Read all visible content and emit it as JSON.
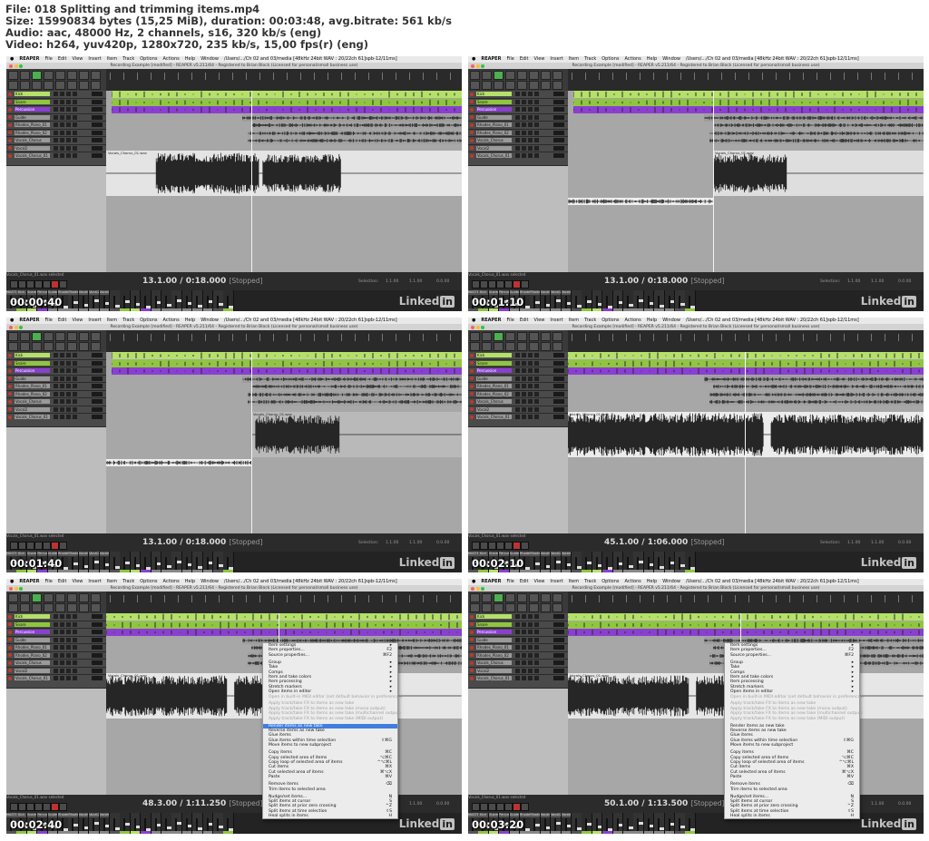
{
  "header": {
    "lines": [
      "File: 018 Splitting and trimming items.mp4",
      "Size: 15990834 bytes (15,25 MiB), duration: 00:03:48, avg.bitrate: 561 kb/s",
      "Audio: aac, 48000 Hz, 2 channels, s16, 320 kb/s (eng)",
      "Video: h264, yuv420p, 1280x720, 235 kb/s, 15,00 fps(r) (eng)"
    ]
  },
  "app": {
    "menu": [
      "REAPER",
      "File",
      "Edit",
      "View",
      "Insert",
      "Item",
      "Track",
      "Options",
      "Actions",
      "Help",
      "Window"
    ],
    "menu_path": "/Users/.../Ch 02 and 03/media [48kHz 24bit WAV : 20/22ch 61]spb-12/11ms]",
    "window_title": "Recording Example [modified] - REAPER v5.211/64 - Registered to Brian Block (Licensed for personal/small business use)",
    "tracks": [
      "Kick",
      "Snare",
      "Percussion",
      "Guide",
      "Rhodes_Piano_01",
      "Rhodes_Piano_02",
      "Vocals_Chorus",
      "Vocal2",
      "Vocals_Chorus_01"
    ],
    "item_label": "Vocals_Chorus_01.wav",
    "transport_label": "Vocals_Chorus_01.wav selected",
    "selection_label": "Selection:",
    "selection_start": "1.1.00",
    "selection_end": "1.1.00",
    "selection_len": "0.0.00",
    "mixer_labels": [
      "MASTER",
      "Kick",
      "Snare",
      "Percussion",
      "Guide",
      "Rhodes_Pi_01",
      "Rhodes_Pi_02",
      "Vocals_Ch",
      "Vocal2",
      "Vocals_Ch_01"
    ],
    "stopped": "[Stopped]",
    "linkedin_text": "Linked",
    "linkedin_in": "in"
  },
  "frames": [
    {
      "timestamp": "00:00:40",
      "position": "13.1.00 / 0:18.000"
    },
    {
      "timestamp": "00:01:10",
      "position": "13.1.00 / 0:18.000"
    },
    {
      "timestamp": "00:01:40",
      "position": "13.1.00 / 0:18.000"
    },
    {
      "timestamp": "00:02:10",
      "position": "45.1.00 / 1:06.000"
    },
    {
      "timestamp": "00:02:40",
      "position": "48.3.00 / 1:11.250"
    },
    {
      "timestamp": "00:03:20",
      "position": "50.1.00 / 1:13.500"
    }
  ],
  "context_menu": {
    "items": [
      {
        "label": "Item settings",
        "shortcut": "▸"
      },
      {
        "label": "Item properties...",
        "shortcut": "F2"
      },
      {
        "label": "Source properties...",
        "shortcut": "⌘F2"
      },
      {
        "sep": true
      },
      {
        "label": "Group",
        "shortcut": "▸"
      },
      {
        "label": "Take",
        "shortcut": "▸"
      },
      {
        "label": "Comps",
        "shortcut": "▸"
      },
      {
        "label": "Item and take colors",
        "shortcut": "▸"
      },
      {
        "label": "Item processing",
        "shortcut": "▸"
      },
      {
        "label": "Stretch markers",
        "shortcut": "▸"
      },
      {
        "label": "Open items in editor",
        "shortcut": "▸"
      },
      {
        "label": "Open in built-in MIDI editor (set default behavior in preferences)",
        "disabled": true
      },
      {
        "sep": true
      },
      {
        "label": "Apply track/take FX to items as new take",
        "disabled": true
      },
      {
        "label": "Apply track/take FX to items as new take (mono output)",
        "disabled": true
      },
      {
        "label": "Apply track/take FX to items as new take (multichannel output)",
        "disabled": true
      },
      {
        "label": "Apply track/take FX to items as new take (MIDI output)",
        "disabled": true
      },
      {
        "sep": true
      },
      {
        "label": "Render items as new take",
        "highlight_in_frame_5": true
      },
      {
        "label": "Reverse items as new take"
      },
      {
        "label": "Glue items"
      },
      {
        "label": "Glue items within time selection",
        "shortcut": "⇧⌘G"
      },
      {
        "label": "Move items to new subproject"
      },
      {
        "sep": true
      },
      {
        "label": "Copy items",
        "shortcut": "⌘C"
      },
      {
        "label": "Copy selected area of items",
        "shortcut": "⌥⌘C"
      },
      {
        "label": "Copy loop of selected area of items",
        "shortcut": "^⌥⌘L"
      },
      {
        "label": "Cut items",
        "shortcut": "⌘X"
      },
      {
        "label": "Cut selected area of items",
        "shortcut": "⌘⌥X"
      },
      {
        "label": "Paste",
        "shortcut": "⌘V"
      },
      {
        "sep": true
      },
      {
        "label": "Remove items",
        "shortcut": "⌫"
      },
      {
        "label": "Trim items to selected area"
      },
      {
        "sep": true
      },
      {
        "label": "Nudge/set items...",
        "shortcut": "N"
      },
      {
        "label": "Split items at cursor",
        "shortcut": "S"
      },
      {
        "label": "Split items at prior zero crossing",
        "shortcut": "^Z"
      },
      {
        "label": "Split items at time selection",
        "shortcut": "⇧S"
      },
      {
        "label": "Heal splits in items",
        "shortcut": "H"
      }
    ]
  },
  "colors": {
    "track_green": "#8fc640",
    "track_lime": "#b5e06a",
    "track_purple": "#8b3fd1",
    "arrange_bg": "#a7a7a7",
    "wave": "#2a2a2a",
    "menu_highlight": "#3f7ee0"
  }
}
